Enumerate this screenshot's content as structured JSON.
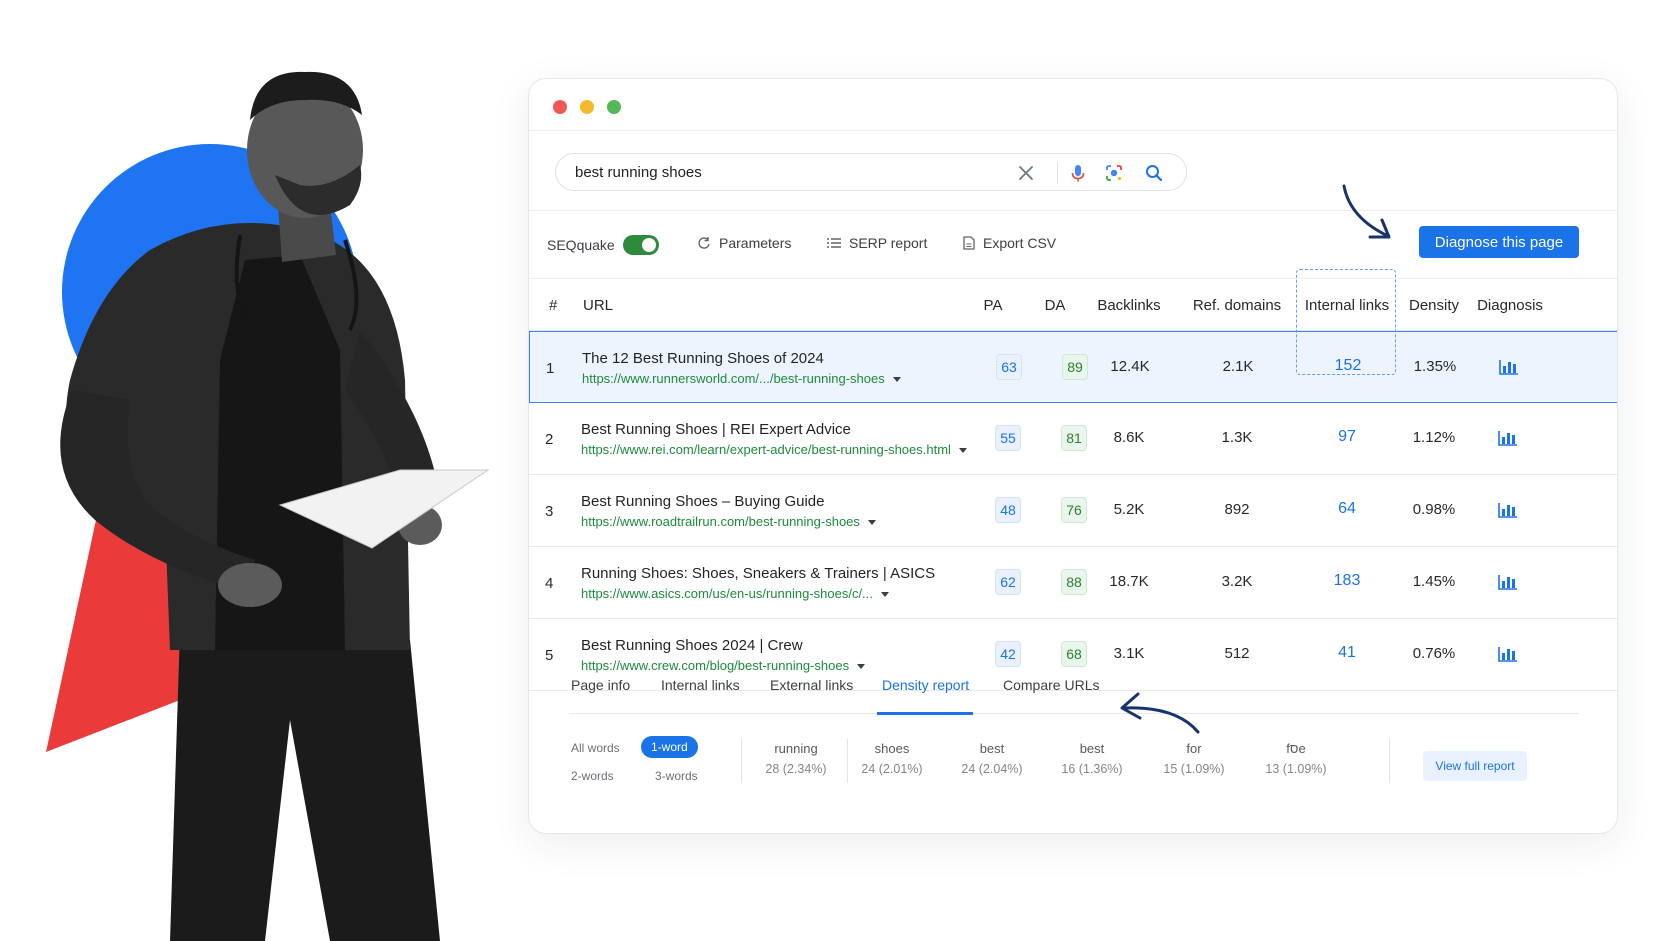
{
  "colors": {
    "accent": "#1a73e8",
    "url_green": "#1e8a3a",
    "decor_blue": "#1f74f1",
    "decor_red": "#ea3a3a"
  },
  "search": {
    "query": "best running shoes"
  },
  "toolbar": {
    "seoquake_label": "SEQquake",
    "parameters_label": "Parameters",
    "serp_report_label": "SERP report",
    "export_csv_label": "Export CSV",
    "diagnose_label": "Diagnose this page"
  },
  "table": {
    "headers": {
      "num": "#",
      "url": "URL",
      "pa": "PA",
      "da": "DA",
      "backlinks": "Backlinks",
      "ref_domains": "Ref. domains",
      "internal_links": "Internal links",
      "density": "Density",
      "diagnosis": "Diagnosis"
    },
    "rows": [
      {
        "num": "1",
        "title": "The 12 Best Running Shoes of 2024",
        "url": "https://www.runnersworld.com/.../best-running-shoes",
        "pa": "63",
        "da": "89",
        "backlinks": "12.4K",
        "ref_domains": "2.1K",
        "internal_links": "152",
        "density": "1.35%"
      },
      {
        "num": "2",
        "title": "Best Running Shoes | REI Expert Advice",
        "url": "https://www.rei.com/learn/expert-advice/best-running-shoes.html",
        "pa": "55",
        "da": "81",
        "backlinks": "8.6K",
        "ref_domains": "1.3K",
        "internal_links": "97",
        "density": "1.12%"
      },
      {
        "num": "3",
        "title": "Best Running Shoes – Buying Guide",
        "url": "https://www.roadtrailrun.com/best-running-shoes",
        "pa": "48",
        "da": "76",
        "backlinks": "5.2K",
        "ref_domains": "892",
        "internal_links": "64",
        "density": "0.98%"
      },
      {
        "num": "4",
        "title": "Running Shoes: Shoes, Sneakers & Trainers | ASICS",
        "url": "https://www.asics.com/us/en-us/running-shoes/c/...",
        "pa": "62",
        "da": "88",
        "backlinks": "18.7K",
        "ref_domains": "3.2K",
        "internal_links": "183",
        "density": "1.45%"
      },
      {
        "num": "5",
        "title": "Best Running Shoes 2024 | Crew",
        "url": "https://www.crew.com/blog/best-running-shoes",
        "pa": "42",
        "da": "68",
        "backlinks": "3.1K",
        "ref_domains": "512",
        "internal_links": "41",
        "density": "0.76%"
      }
    ]
  },
  "tabs": {
    "page_info": "Page info",
    "internal_links": "Internal links",
    "external_links": "External links",
    "density_report": "Density report",
    "compare_urls": "Compare URLs"
  },
  "density": {
    "filters": {
      "all_words": "All words",
      "one_word": "1-word",
      "two_words": "2-words",
      "three_words": "3-words"
    },
    "words": [
      {
        "word": "running",
        "count": "28 (2.34%)"
      },
      {
        "word": "shoes",
        "count": "24 (2.01%)"
      },
      {
        "word": "best",
        "count": "24 (2.04%)"
      },
      {
        "word": "best",
        "count": "16 (1.36%)"
      },
      {
        "word": "for",
        "count": "15 (1.09%)"
      },
      {
        "word": "fסe",
        "count": "13 (1.09%)"
      }
    ],
    "view_full_report": "View full report"
  }
}
